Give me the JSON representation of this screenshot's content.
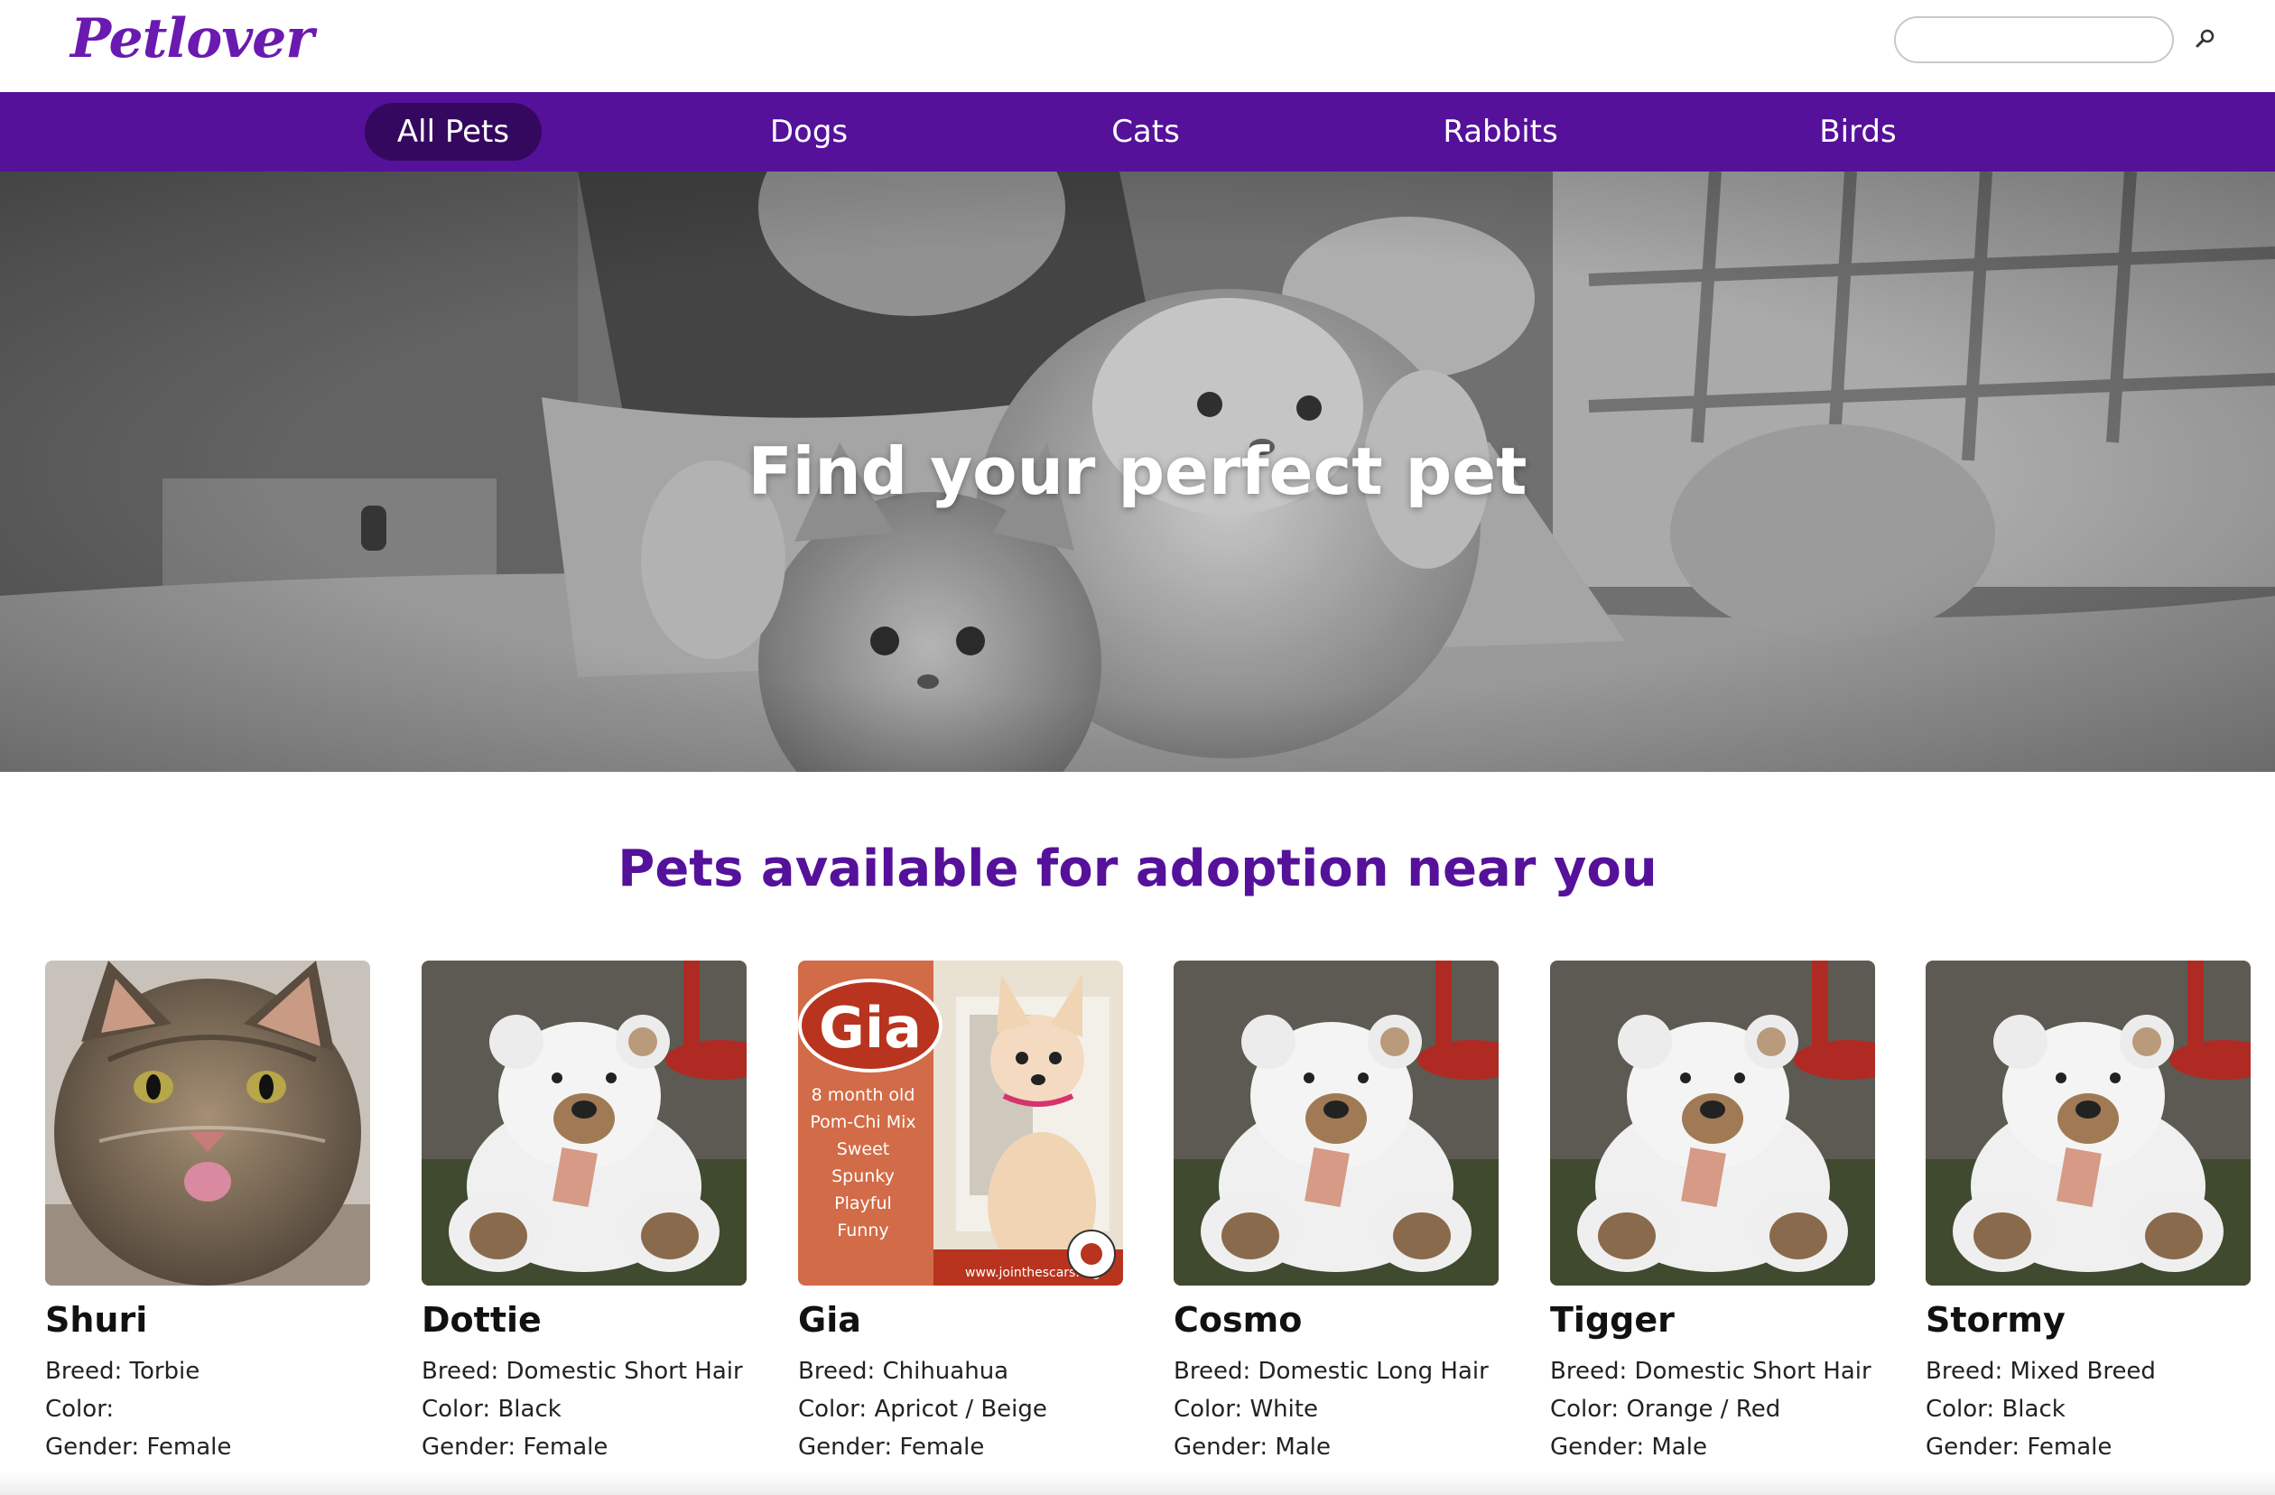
{
  "brand": {
    "logo_text": "Petlover",
    "accent": "#55119a",
    "active_tab_color": "#34085f"
  },
  "search": {
    "placeholder": "",
    "value": "",
    "icon": "search-icon"
  },
  "nav": {
    "items": [
      {
        "label": "All Pets",
        "active": true
      },
      {
        "label": "Dogs",
        "active": false
      },
      {
        "label": "Cats",
        "active": false
      },
      {
        "label": "Rabbits",
        "active": false
      },
      {
        "label": "Birds",
        "active": false
      }
    ]
  },
  "hero": {
    "title": "Find your perfect pet"
  },
  "section": {
    "title": "Pets available for adoption near you"
  },
  "pets": [
    {
      "name": "Shuri",
      "breed": "Breed: Torbie",
      "color": "Color:",
      "gender": "Gender: Female",
      "photo": "tabby-cat-photo"
    },
    {
      "name": "Dottie",
      "breed": "Breed: Domestic Short Hair",
      "color": "Color: Black",
      "gender": "Gender: Female",
      "photo": "teddy-bear-placeholder-photo"
    },
    {
      "name": "Gia",
      "breed": "Breed: Chihuahua",
      "color": "Color: Apricot / Beige",
      "gender": "Gender: Female",
      "photo": "chihuahua-flyer-photo",
      "flyer": {
        "name": "Gia",
        "lines": [
          "8 month old",
          "Pom-Chi Mix",
          "Sweet",
          "Spunky",
          "Playful",
          "Funny"
        ],
        "url": "www.jointhescars.org"
      }
    },
    {
      "name": "Cosmo",
      "breed": "Breed: Domestic Long Hair",
      "color": "Color: White",
      "gender": "Gender: Male",
      "photo": "teddy-bear-placeholder-photo"
    },
    {
      "name": "Tigger",
      "breed": "Breed: Domestic Short Hair",
      "color": "Color: Orange / Red",
      "gender": "Gender: Male",
      "photo": "teddy-bear-placeholder-photo"
    },
    {
      "name": "Stormy",
      "breed": "Breed: Mixed Breed",
      "color": "Color: Black",
      "gender": "Gender: Female",
      "photo": "teddy-bear-placeholder-photo"
    }
  ]
}
